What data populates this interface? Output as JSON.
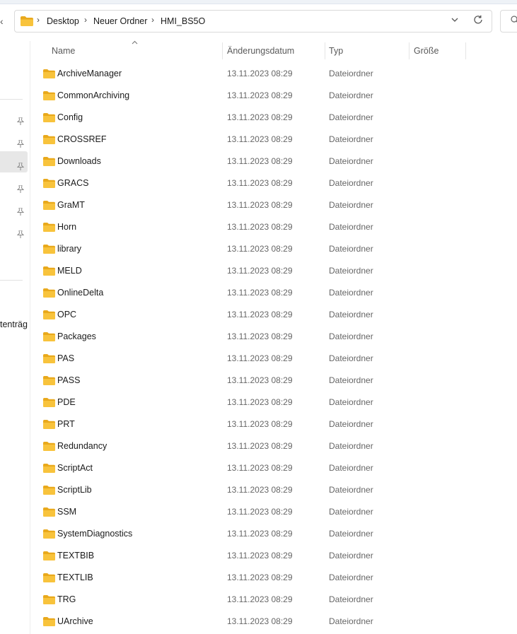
{
  "address_bar": {
    "segments": [
      "Desktop",
      "Neuer Ordner",
      "HMI_BS5O"
    ]
  },
  "columns": {
    "name": "Name",
    "date": "Änderungsdatum",
    "type": "Typ",
    "size": "Größe"
  },
  "sidebar": {
    "partial_label": "tenträg"
  },
  "files": [
    {
      "name": "ArchiveManager",
      "date": "13.11.2023 08:29",
      "type": "Dateiordner"
    },
    {
      "name": "CommonArchiving",
      "date": "13.11.2023 08:29",
      "type": "Dateiordner"
    },
    {
      "name": "Config",
      "date": "13.11.2023 08:29",
      "type": "Dateiordner"
    },
    {
      "name": "CROSSREF",
      "date": "13.11.2023 08:29",
      "type": "Dateiordner"
    },
    {
      "name": "Downloads",
      "date": "13.11.2023 08:29",
      "type": "Dateiordner"
    },
    {
      "name": "GRACS",
      "date": "13.11.2023 08:29",
      "type": "Dateiordner"
    },
    {
      "name": "GraMT",
      "date": "13.11.2023 08:29",
      "type": "Dateiordner"
    },
    {
      "name": "Horn",
      "date": "13.11.2023 08:29",
      "type": "Dateiordner"
    },
    {
      "name": "library",
      "date": "13.11.2023 08:29",
      "type": "Dateiordner"
    },
    {
      "name": "MELD",
      "date": "13.11.2023 08:29",
      "type": "Dateiordner"
    },
    {
      "name": "OnlineDelta",
      "date": "13.11.2023 08:29",
      "type": "Dateiordner"
    },
    {
      "name": "OPC",
      "date": "13.11.2023 08:29",
      "type": "Dateiordner"
    },
    {
      "name": "Packages",
      "date": "13.11.2023 08:29",
      "type": "Dateiordner"
    },
    {
      "name": "PAS",
      "date": "13.11.2023 08:29",
      "type": "Dateiordner"
    },
    {
      "name": "PASS",
      "date": "13.11.2023 08:29",
      "type": "Dateiordner"
    },
    {
      "name": "PDE",
      "date": "13.11.2023 08:29",
      "type": "Dateiordner"
    },
    {
      "name": "PRT",
      "date": "13.11.2023 08:29",
      "type": "Dateiordner"
    },
    {
      "name": "Redundancy",
      "date": "13.11.2023 08:29",
      "type": "Dateiordner"
    },
    {
      "name": "ScriptAct",
      "date": "13.11.2023 08:29",
      "type": "Dateiordner"
    },
    {
      "name": "ScriptLib",
      "date": "13.11.2023 08:29",
      "type": "Dateiordner"
    },
    {
      "name": "SSM",
      "date": "13.11.2023 08:29",
      "type": "Dateiordner"
    },
    {
      "name": "SystemDiagnostics",
      "date": "13.11.2023 08:29",
      "type": "Dateiordner"
    },
    {
      "name": "TEXTBIB",
      "date": "13.11.2023 08:29",
      "type": "Dateiordner"
    },
    {
      "name": "TEXTLIB",
      "date": "13.11.2023 08:29",
      "type": "Dateiordner"
    },
    {
      "name": "TRG",
      "date": "13.11.2023 08:29",
      "type": "Dateiordner"
    },
    {
      "name": "UArchive",
      "date": "13.11.2023 08:29",
      "type": "Dateiordner"
    }
  ],
  "colors": {
    "folder": "#f8c33c",
    "folder_tab": "#e9a91c"
  }
}
